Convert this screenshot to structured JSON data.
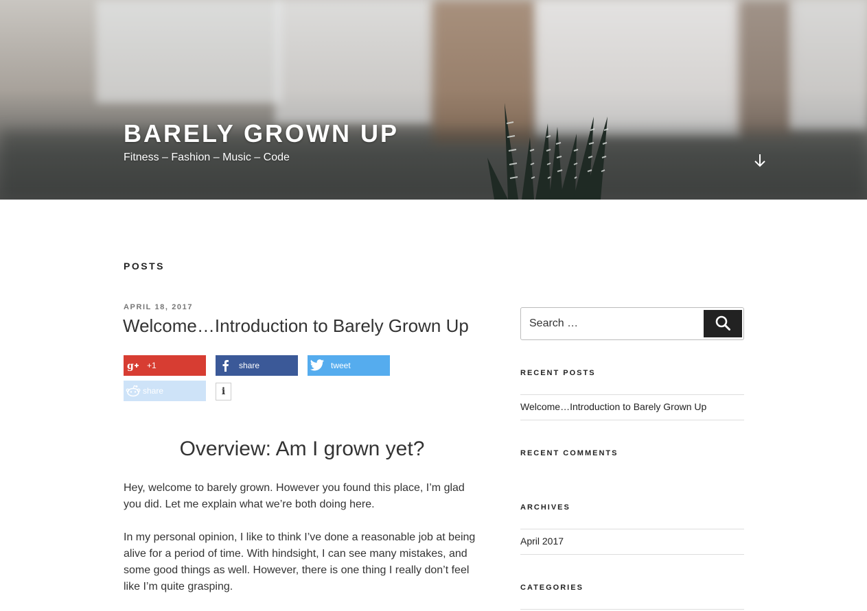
{
  "header": {
    "site_title": "BARELY GROWN UP",
    "site_description": "Fitness – Fashion – Music – Code",
    "scroll_icon": "arrow-down-icon"
  },
  "main": {
    "page_heading": "POSTS",
    "post": {
      "date": "APRIL 18, 2017",
      "title": "Welcome…Introduction to Barely Grown Up",
      "share_buttons": [
        {
          "label": "+1",
          "icon": "google-plus-icon",
          "color": "#d73d32"
        },
        {
          "label": "share",
          "icon": "facebook-icon",
          "color": "#3b5998"
        },
        {
          "label": "tweet",
          "icon": "twitter-icon",
          "color": "#55acee"
        },
        {
          "label": "share",
          "icon": "reddit-icon",
          "color": "#cee3f8"
        }
      ],
      "info_label": "i",
      "subheading": "Overview: Am I grown yet?",
      "paragraphs": [
        "Hey, welcome to barely grown. However you found this place, I’m glad you did. Let me explain what we’re both doing here.",
        "In my personal opinion, I like to think I’ve done a reasonable job at being alive for a period of time. With hindsight, I can see many mistakes, and some good things as well. However, there is one thing I really don’t feel like I’m quite grasping."
      ]
    }
  },
  "sidebar": {
    "search": {
      "placeholder": "Search …",
      "icon": "search-icon"
    },
    "recent_posts": {
      "title": "RECENT POSTS",
      "items": [
        "Welcome…Introduction to Barely Grown Up"
      ]
    },
    "recent_comments": {
      "title": "RECENT COMMENTS"
    },
    "archives": {
      "title": "ARCHIVES",
      "items": [
        "April 2017"
      ]
    },
    "categories": {
      "title": "CATEGORIES"
    }
  }
}
